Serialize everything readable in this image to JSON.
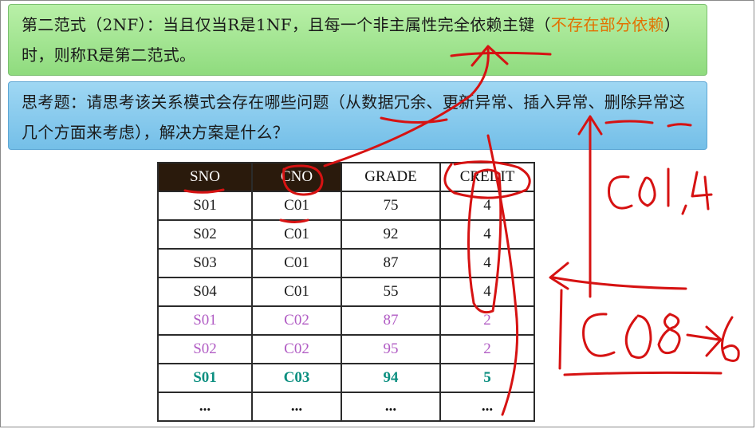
{
  "definition": {
    "text_main": "第二范式（2NF）：当且仅当R是1NF，且每一个非主属性完全依赖主键（",
    "text_highlight": "不存在部分依赖",
    "text_end": "）时，则称R是第二范式。",
    "highlight_color": "#e27100"
  },
  "question": {
    "text": "思考题：请思考该关系模式会存在哪些问题（从数据冗余、更新异常、插入异常、删除异常这几个方面来考虑），解决方案是什么？"
  },
  "table": {
    "headers": [
      "SNO",
      "CNO",
      "GRADE",
      "CREDIT"
    ],
    "rows": [
      [
        "S01",
        "C01",
        "75",
        "4"
      ],
      [
        "S02",
        "C01",
        "92",
        "4"
      ],
      [
        "S03",
        "C01",
        "87",
        "4"
      ],
      [
        "S04",
        "C01",
        "55",
        "4"
      ],
      [
        "S01",
        "C02",
        "87",
        "2"
      ],
      [
        "S02",
        "C02",
        "95",
        "2"
      ],
      [
        "S01",
        "C03",
        "94",
        "5"
      ],
      [
        "...",
        "...",
        "...",
        "..."
      ]
    ]
  },
  "annotations": {
    "note_top": "C01 , 4",
    "note_bottom": "C08 → 6",
    "ink_color": "#d61212"
  }
}
